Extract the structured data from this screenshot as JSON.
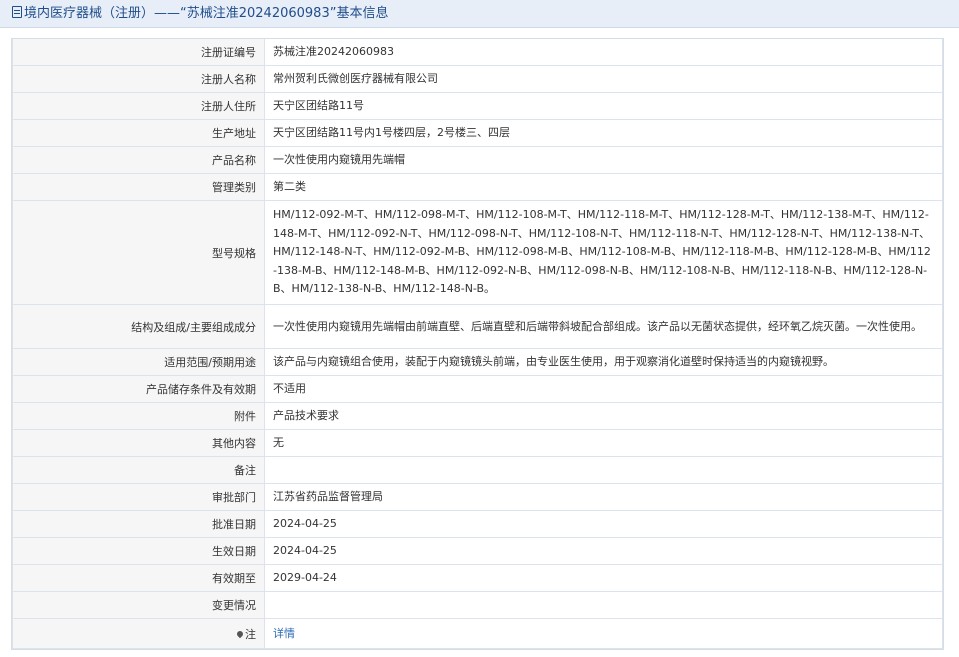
{
  "header": {
    "title": "境内医疗器械（注册）——“苏械注准20242060983”基本信息"
  },
  "rows": [
    {
      "label": "注册证编号",
      "value": "苏械注准20242060983"
    },
    {
      "label": "注册人名称",
      "value": "常州贺利氏微创医疗器械有限公司"
    },
    {
      "label": "注册人住所",
      "value": "天宁区团结路11号"
    },
    {
      "label": "生产地址",
      "value": "天宁区团结路11号内1号楼四层，2号楼三、四层"
    },
    {
      "label": "产品名称",
      "value": "一次性使用内窥镜用先端帽"
    },
    {
      "label": "管理类别",
      "value": "第二类"
    },
    {
      "label": "型号规格",
      "value": "HM/112-092-M-T、HM/112-098-M-T、HM/112-108-M-T、HM/112-118-M-T、HM/112-128-M-T、HM/112-138-M-T、HM/112-148-M-T、HM/112-092-N-T、HM/112-098-N-T、HM/112-108-N-T、HM/112-118-N-T、HM/112-128-N-T、HM/112-138-N-T、HM/112-148-N-T、HM/112-092-M-B、HM/112-098-M-B、HM/112-108-M-B、HM/112-118-M-B、HM/112-128-M-B、HM/112-138-M-B、HM/112-148-M-B、HM/112-092-N-B、HM/112-098-N-B、HM/112-108-N-B、HM/112-118-N-B、HM/112-128-N-B、HM/112-138-N-B、HM/112-148-N-B。"
    },
    {
      "label": "结构及组成/主要组成成分",
      "value": "一次性使用内窥镜用先端帽由前端直壁、后端直壁和后端带斜坡配合部组成。该产品以无菌状态提供，经环氧乙烷灭菌。一次性使用。"
    },
    {
      "label": "适用范围/预期用途",
      "value": "该产品与内窥镜组合使用，装配于内窥镜镜头前端，由专业医生使用，用于观察消化道壁时保持适当的内窥镜视野。"
    },
    {
      "label": "产品储存条件及有效期",
      "value": "不适用"
    },
    {
      "label": "附件",
      "value": "产品技术要求"
    },
    {
      "label": "其他内容",
      "value": "无"
    },
    {
      "label": "备注",
      "value": ""
    },
    {
      "label": "审批部门",
      "value": "江苏省药品监督管理局"
    },
    {
      "label": "批准日期",
      "value": "2024-04-25"
    },
    {
      "label": "生效日期",
      "value": "2024-04-25"
    },
    {
      "label": "有效期至",
      "value": "2029-04-24"
    },
    {
      "label": "变更情况",
      "value": ""
    },
    {
      "label": "注",
      "value": "详情"
    }
  ]
}
